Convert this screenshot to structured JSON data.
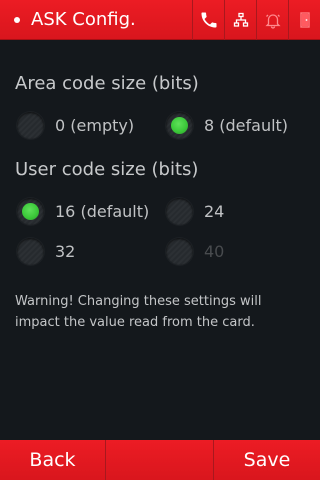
{
  "header": {
    "title": "ASK Config.",
    "icons": [
      "phone-icon",
      "network-icon",
      "bell-icon",
      "door-exit-icon"
    ]
  },
  "area_code": {
    "label": "Area code size (bits)",
    "options": [
      {
        "label": "0 (empty)",
        "selected": false,
        "enabled": true
      },
      {
        "label": "8 (default)",
        "selected": true,
        "enabled": true
      }
    ]
  },
  "user_code": {
    "label": "User code size (bits)",
    "options": [
      {
        "label": "16 (default)",
        "selected": true,
        "enabled": true
      },
      {
        "label": "24",
        "selected": false,
        "enabled": true
      },
      {
        "label": "32",
        "selected": false,
        "enabled": true
      },
      {
        "label": "40",
        "selected": false,
        "enabled": false
      }
    ]
  },
  "warning": "Warning! Changing these settings will impact the value read from the card.",
  "footer": {
    "back_label": "Back",
    "save_label": "Save"
  },
  "colors": {
    "header_red": "#e31b23",
    "background": "#14181c",
    "selected_green": "#3cc93a",
    "text": "#c0c2c4",
    "disabled_text": "#484b4e"
  }
}
